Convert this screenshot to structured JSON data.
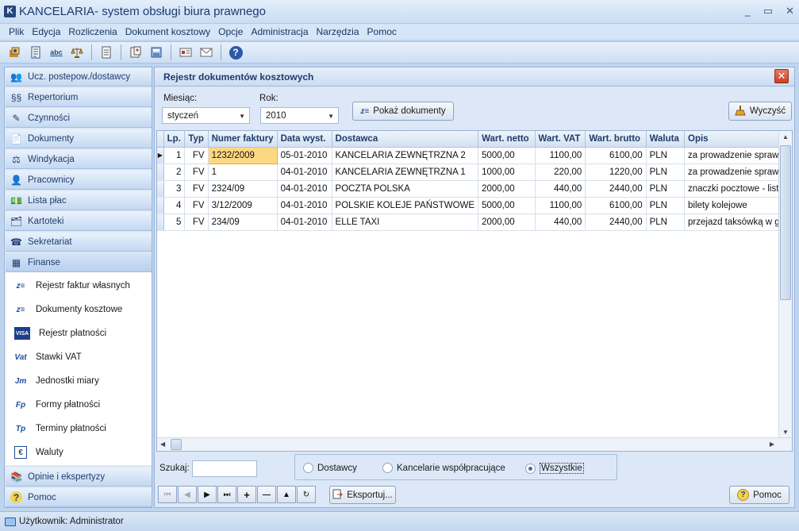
{
  "window": {
    "app_icon": "K",
    "title": "KANCELARIA- system obsługi biura prawnego",
    "minimize": "_",
    "maximize": "▭",
    "close": "✕"
  },
  "menu": [
    "Plik",
    "Edycja",
    "Rozliczenia",
    "Dokument kosztowy",
    "Opcje",
    "Administracja",
    "Narzędzia",
    "Pomoc"
  ],
  "toolbar_icons": [
    "contacts-icon",
    "repertorium-icon",
    "spellcheck-icon",
    "scales-icon",
    "document-icon",
    "report-icon",
    "calculator-icon",
    "card-icon",
    "mail-icon",
    "help-icon"
  ],
  "toolbar": {
    "spellcheck": "abc",
    "help": "?"
  },
  "sidebar": {
    "top_items": [
      {
        "label": "Ucz. postepow./dostawcy",
        "icon": "people-icon",
        "glyph": "👥"
      },
      {
        "label": "Repertorium",
        "icon": "paragraph-icon",
        "glyph": "§§"
      },
      {
        "label": "Czynności",
        "icon": "tasks-icon",
        "glyph": "✎"
      },
      {
        "label": "Dokumenty",
        "icon": "documents-icon",
        "glyph": "📄"
      },
      {
        "label": "Windykacja",
        "icon": "debt-collection-icon",
        "glyph": "⚖"
      },
      {
        "label": "Pracownicy",
        "icon": "employees-icon",
        "glyph": "👤"
      },
      {
        "label": "Lista płac",
        "icon": "payroll-icon",
        "glyph": "💵"
      },
      {
        "label": "Kartoteki",
        "icon": "folders-icon",
        "glyph": "🗂"
      },
      {
        "label": "Sekretariat",
        "icon": "phone-icon",
        "glyph": "☎"
      },
      {
        "label": "Finanse",
        "icon": "finance-icon",
        "glyph": "▦"
      }
    ],
    "sub_items": [
      {
        "label": "Rejestr faktur własnych",
        "icon": "invoice-register-icon",
        "glyph": "z≡"
      },
      {
        "label": "Dokumenty kosztowe",
        "icon": "cost-documents-icon",
        "glyph": "z≡"
      },
      {
        "label": "Rejestr płatności",
        "icon": "visa-card-icon",
        "glyph": "VISA"
      },
      {
        "label": "Stawki VAT",
        "icon": "vat-icon",
        "glyph": "Vat"
      },
      {
        "label": "Jednostki miary",
        "icon": "units-icon",
        "glyph": "Jm"
      },
      {
        "label": "Formy płatności",
        "icon": "payment-forms-icon",
        "glyph": "Fp"
      },
      {
        "label": "Terminy płatności",
        "icon": "payment-terms-icon",
        "glyph": "Tp"
      },
      {
        "label": "Waluty",
        "icon": "currency-icon",
        "glyph": "€"
      }
    ],
    "bottom_items": [
      {
        "label": "Opinie i ekspertyzy",
        "icon": "opinions-icon",
        "glyph": "📚"
      },
      {
        "label": "Pomoc",
        "icon": "help-icon",
        "glyph": "?"
      }
    ]
  },
  "panel": {
    "title": "Rejestr dokumentów kosztowych",
    "close": "✕",
    "month_label": "Miesiąc:",
    "month_value": "styczeń",
    "year_label": "Rok:",
    "year_value": "2010",
    "show_button": "Pokaż dokumenty",
    "clear_button": "Wyczyść"
  },
  "grid": {
    "columns": [
      "Lp.",
      "Typ",
      "Numer faktury",
      "Data wyst.",
      "Dostawca",
      "Wart. netto",
      "Wart. VAT",
      "Wart. brutto",
      "Waluta",
      "Opis"
    ],
    "rows": [
      [
        "1",
        "FV",
        "1232/2009",
        "05-01-2010",
        "KANCELARIA ZEWNĘTRZNA 2",
        "5000,00",
        "1100,00",
        "6100,00",
        "PLN",
        "za prowadzenie sprawy"
      ],
      [
        "2",
        "FV",
        "1",
        "04-01-2010",
        "KANCELARIA ZEWNĘTRZNA 1",
        "1000,00",
        "220,00",
        "1220,00",
        "PLN",
        "za prowadzenie sprawy"
      ],
      [
        "3",
        "FV",
        "2324/09",
        "04-01-2010",
        "POCZTA POLSKA",
        "2000,00",
        "440,00",
        "2440,00",
        "PLN",
        "znaczki pocztowe - listy"
      ],
      [
        "4",
        "FV",
        "3/12/2009",
        "04-01-2010",
        "POLSKIE KOLEJE PAŃSTWOWE",
        "5000,00",
        "1100,00",
        "6100,00",
        "PLN",
        "bilety kolejowe"
      ],
      [
        "5",
        "FV",
        "234/09",
        "04-01-2010",
        "ELLE TAXI",
        "2000,00",
        "440,00",
        "2440,00",
        "PLN",
        "przejazd taksówką w gru"
      ]
    ]
  },
  "filter": {
    "search_label": "Szukaj:",
    "search_value": "",
    "radio_suppliers": "Dostawcy",
    "radio_partners": "Kancelarie współpracujące",
    "radio_all": "Wszystkie",
    "selected": "Wszystkie"
  },
  "nav_buttons": [
    "⏮",
    "◀",
    "▶",
    "⏭",
    "+",
    "—",
    "▲",
    "↻"
  ],
  "export_button": "Eksportuj...",
  "help_button": "Pomoc",
  "status": {
    "user_text": "Użytkownik: Administrator"
  }
}
